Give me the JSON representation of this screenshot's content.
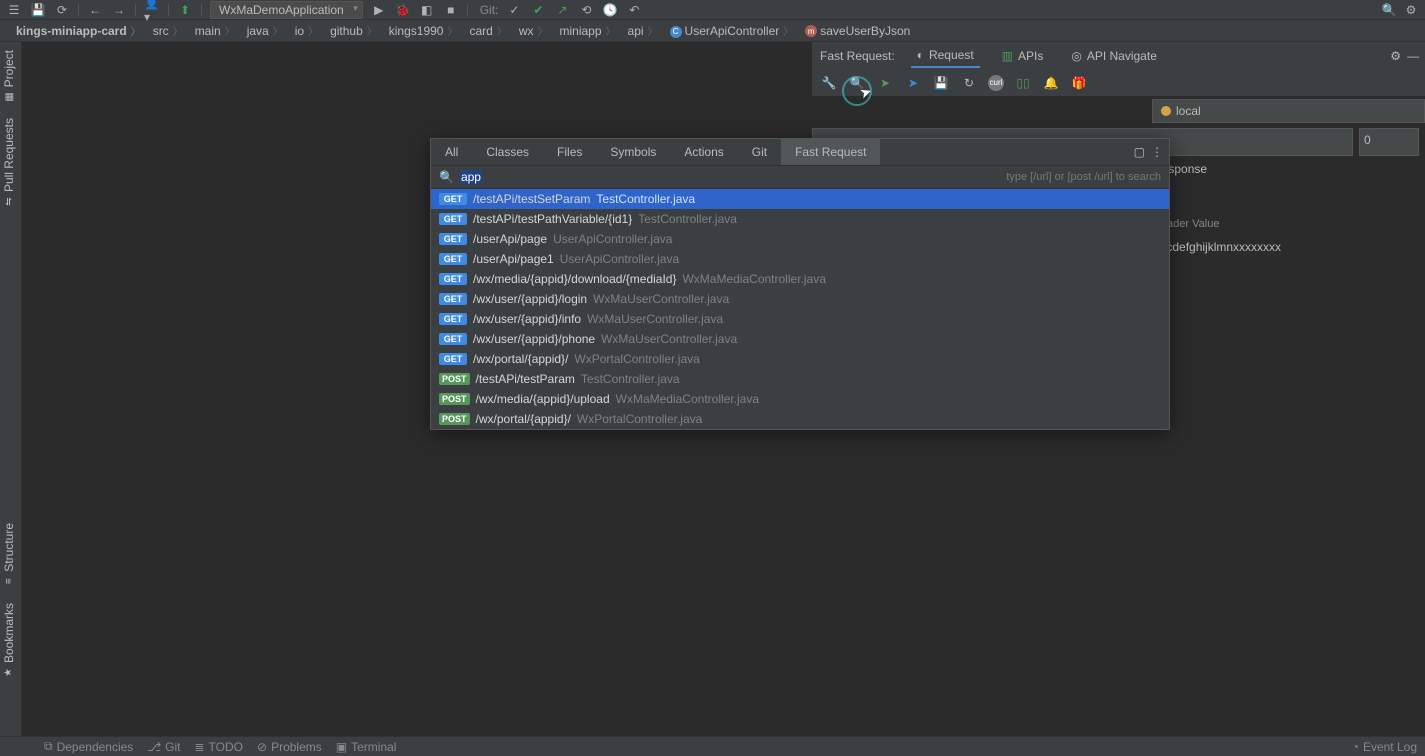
{
  "toolbar": {
    "run_config": "WxMaDemoApplication",
    "git_label": "Git:"
  },
  "breadcrumb": [
    "kings-miniapp-card",
    "src",
    "main",
    "java",
    "io",
    "github",
    "kings1990",
    "card",
    "wx",
    "miniapp",
    "api"
  ],
  "breadcrumb_class": "UserApiController",
  "breadcrumb_method": "saveUserByJson",
  "left_tabs": [
    "Project",
    "Pull Requests",
    "Structure",
    "Bookmarks"
  ],
  "fast_request": {
    "label": "Fast Request:",
    "tabs": [
      "Request",
      "APIs",
      "API Navigate"
    ],
    "env": "local",
    "num": "0",
    "response_label": "Response",
    "header_value_label": "Header Value",
    "header_value": "abcdefghijklmnxxxxxxxx"
  },
  "search_everywhere": {
    "tabs": [
      "All",
      "Classes",
      "Files",
      "Symbols",
      "Actions",
      "Git",
      "Fast Request"
    ],
    "active_tab": "Fast Request",
    "query": "app",
    "hint": "type [/url] or [post /url] to search",
    "results": [
      {
        "method": "GET",
        "path": "/testAPi/testSetParam",
        "file": "TestController.java",
        "selected": true
      },
      {
        "method": "GET",
        "path": "/testAPi/testPathVariable/{id1}",
        "file": "TestController.java"
      },
      {
        "method": "GET",
        "path": "/userApi/page",
        "file": "UserApiController.java"
      },
      {
        "method": "GET",
        "path": "/userApi/page1",
        "file": "UserApiController.java"
      },
      {
        "method": "GET",
        "path": "/wx/media/{appid}/download/{mediaId}",
        "file": "WxMaMediaController.java"
      },
      {
        "method": "GET",
        "path": "/wx/user/{appid}/login",
        "file": "WxMaUserController.java"
      },
      {
        "method": "GET",
        "path": "/wx/user/{appid}/info",
        "file": "WxMaUserController.java"
      },
      {
        "method": "GET",
        "path": "/wx/user/{appid}/phone",
        "file": "WxMaUserController.java"
      },
      {
        "method": "GET",
        "path": "/wx/portal/{appid}/",
        "file": "WxPortalController.java"
      },
      {
        "method": "POST",
        "path": "/testAPi/testParam",
        "file": "TestController.java"
      },
      {
        "method": "POST",
        "path": "/wx/media/{appid}/upload",
        "file": "WxMaMediaController.java"
      },
      {
        "method": "POST",
        "path": "/wx/portal/{appid}/",
        "file": "WxPortalController.java"
      }
    ]
  },
  "status_bar": {
    "items": [
      "Dependencies",
      "Git",
      "TODO",
      "Problems",
      "Terminal"
    ],
    "right": "Event Log"
  }
}
